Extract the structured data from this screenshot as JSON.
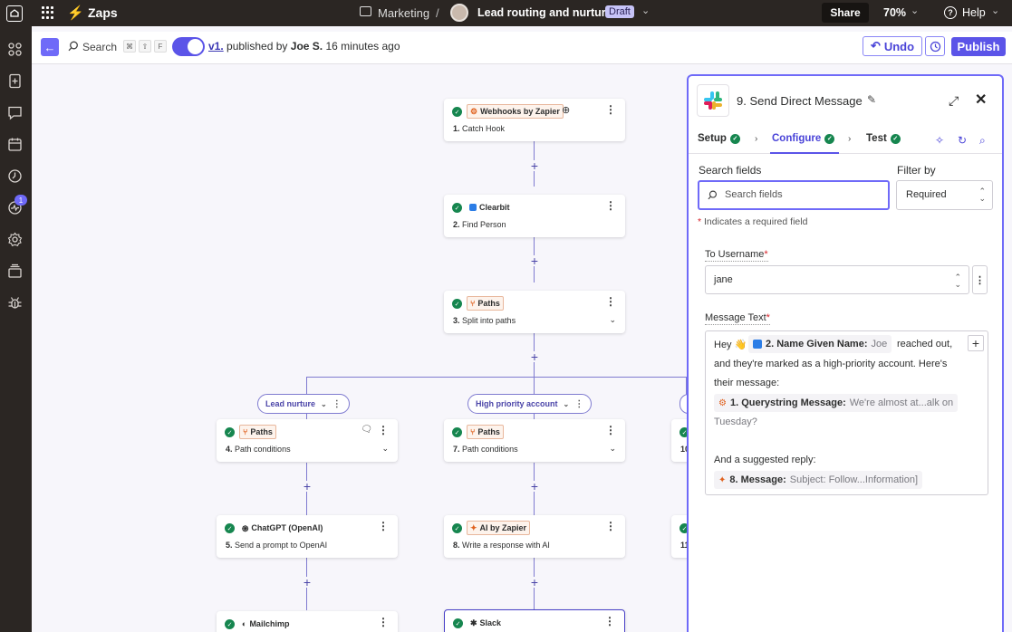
{
  "topbar": {
    "brand": "Zaps",
    "breadcrumb_folder": "Marketing",
    "breadcrumb_sep": "/",
    "zap_name": "Lead routing and nurture",
    "status_badge": "Draft",
    "share_label": "Share",
    "zoom": "70%",
    "help_label": "Help"
  },
  "sidebar": {
    "badge_count": "1",
    "icons": [
      "apps-icon",
      "zap-add-icon",
      "chat-icon",
      "calendar-icon",
      "history-icon",
      "activity-icon",
      "settings-icon",
      "layers-icon",
      "bug-icon"
    ]
  },
  "subbar": {
    "search_label": "Search",
    "shortcut_keys": [
      "⌘",
      "⇧",
      "F"
    ],
    "version": "v1.",
    "published_by_text": "published by",
    "publisher": "Joe S.",
    "published_time": "16 minutes ago",
    "undo_label": "Undo",
    "publish_label": "Publish"
  },
  "steps": [
    {
      "app": "Webhooks by Zapier",
      "num": "1.",
      "title": "Catch Hook"
    },
    {
      "app": "Clearbit",
      "num": "2.",
      "title": "Find Person"
    },
    {
      "app": "Paths",
      "num": "3.",
      "title": "Split into paths"
    },
    {
      "app": "Paths",
      "num": "4.",
      "title": "Path conditions"
    },
    {
      "app": "Paths",
      "num": "7.",
      "title": "Path conditions"
    },
    {
      "app": "ChatGPT (OpenAI)",
      "num": "5.",
      "title": "Send a prompt to OpenAI"
    },
    {
      "app": "AI by Zapier",
      "num": "8.",
      "title": "Write a response with AI"
    },
    {
      "app": "Mailchimp",
      "num": "",
      "title": ""
    },
    {
      "app": "Slack",
      "num": "",
      "title": ""
    }
  ],
  "partial_steps": [
    "10",
    "11"
  ],
  "paths": {
    "lead_nurture": "Lead nurture",
    "high_priority": "High priority account"
  },
  "panel": {
    "title": "9. Send Direct Message",
    "tabs": {
      "setup": "Setup",
      "configure": "Configure",
      "test": "Test"
    },
    "search_fields_label": "Search fields",
    "search_placeholder": "Search fields",
    "filter_label": "Filter by",
    "filter_value": "Required",
    "required_note_star": "*",
    "required_note": "Indicates a required field",
    "to_username_label": "To Username",
    "to_username_value": "jane",
    "message_label": "Message Text",
    "message": {
      "hey": "Hey 👋",
      "pill1_key": "2. Name Given Name:",
      "pill1_val": "Joe",
      "reached": "reached out,",
      "line2": "and they're marked as a high-priority account. Here's",
      "line3": "their message:",
      "pill2_key": "1. Querystring Message:",
      "pill2_val": "We're almost at...alk on",
      "line5": "Tuesday?",
      "line6": "And a suggested reply:",
      "pill3_key": "8. Message:",
      "pill3_val": "Subject: Follow...Information]"
    }
  },
  "colors": {
    "accent": "#5b54e8",
    "topbar": "#2b2623",
    "success": "#16864f",
    "zapier_orange": "#ff4f00",
    "connector": "#7f7bd0"
  }
}
